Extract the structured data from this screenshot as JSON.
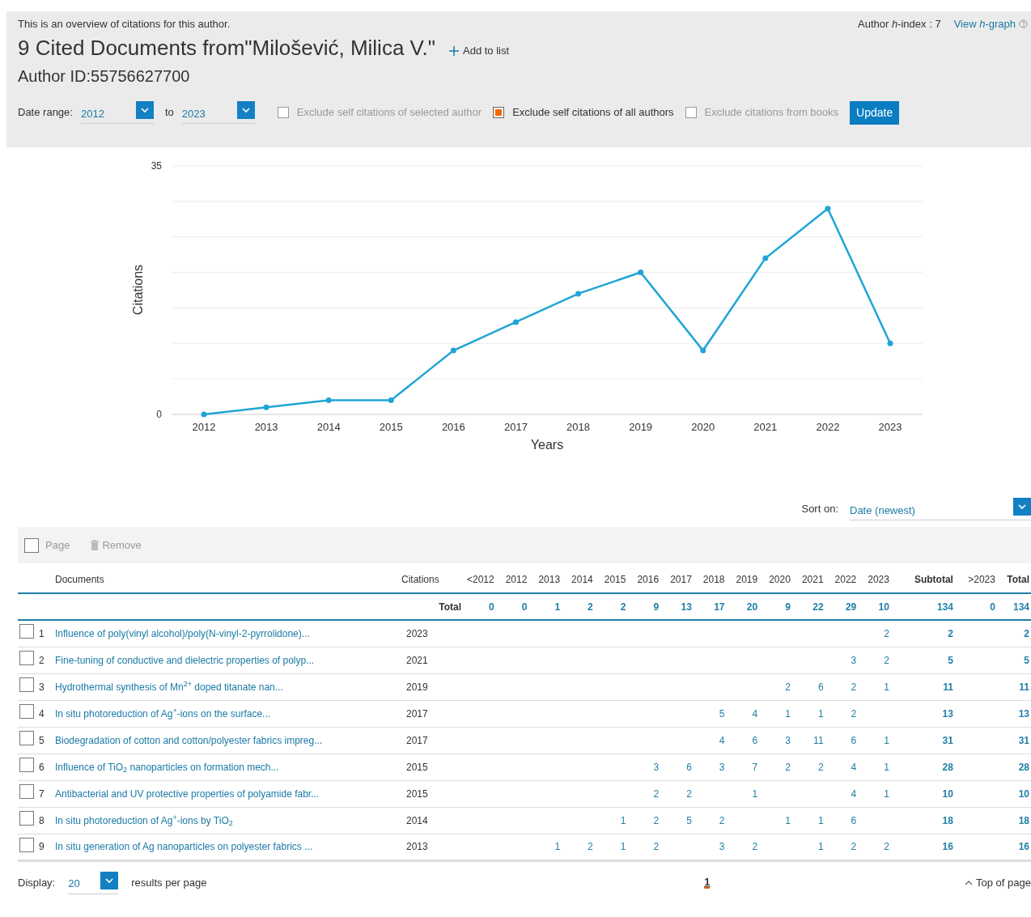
{
  "header": {
    "intro": "This is an overview of citations for this author.",
    "h_index": "Author *h*-index : 7",
    "h_graph_link": "View *h*-graph",
    "title": "9 Cited Documents from\"Milošević, Milica V.\"",
    "add_to_list": "Add to list",
    "author_id": "Author ID:55756627700"
  },
  "date_range": {
    "label": "Date range:",
    "from": "2012",
    "to_label": "to",
    "to": "2023"
  },
  "filters": [
    {
      "label": "Exclude self citations of selected author",
      "checked": false
    },
    {
      "label": "Exclude self citations of all authors",
      "checked": true
    },
    {
      "label": "Exclude citations from books",
      "checked": false
    }
  ],
  "update_button": "Update",
  "chart": {
    "chart_data": {
      "type": "line",
      "xlabel": "Years",
      "ylabel": "Citations",
      "categories": [
        "2012",
        "2013",
        "2014",
        "2015",
        "2016",
        "2017",
        "2018",
        "2019",
        "2020",
        "2021",
        "2022",
        "2023"
      ],
      "series": [
        {
          "color": "#1fa5d6",
          "marker": "circle",
          "values": [
            0,
            1,
            2,
            2,
            9,
            13,
            17,
            20,
            9,
            22,
            29,
            10
          ]
        }
      ],
      "ylim": [
        0,
        35
      ],
      "yticks": [
        0,
        35
      ]
    }
  },
  "sort": {
    "label": "Sort on:",
    "value": "Date (newest)"
  },
  "toolbar": {
    "page_label": "Page",
    "page_checked": false,
    "remove": "Remove"
  },
  "table": {
    "columns": [
      "Documents",
      "Citations",
      "<2012",
      "2012",
      "2013",
      "2014",
      "2015",
      "2016",
      "2017",
      "2018",
      "2019",
      "2020",
      "2021",
      "2022",
      "2023",
      "Subtotal",
      ">2023",
      "Total"
    ],
    "total_row": {
      "label": "Total",
      "values": [
        "0",
        "0",
        "1",
        "2",
        "2",
        "9",
        "13",
        "17",
        "20",
        "9",
        "22",
        "29",
        "10",
        "134",
        "0",
        "134"
      ]
    },
    "rows": [
      {
        "number": "1",
        "title": "Influence of poly(vinyl alcohol)/poly(N-vinyl-2-pyrrolidone)...",
        "year": "2023",
        "checked": false,
        "cells": {
          "col_13": "2",
          "col_14": "2",
          "col_16": "2"
        }
      },
      {
        "number": "2",
        "title": "Fine-tuning of conductive and dielectric properties of polyp...",
        "year": "2021",
        "checked": false,
        "cells": {
          "col_12": "3",
          "col_13": "2",
          "col_14": "5",
          "col_16": "5"
        }
      },
      {
        "number": "3",
        "title": "Hydrothermal synthesis of Mn$^{2+}$ doped titanate nan...",
        "year": "2019",
        "checked": false,
        "cells": {
          "col_10": "2",
          "col_11": "6",
          "col_12": "2",
          "col_13": "1",
          "col_14": "11",
          "col_16": "11"
        }
      },
      {
        "number": "4",
        "title": "In situ photoreduction of Ag$^{+}$-ions on the surface...",
        "year": "2017",
        "checked": false,
        "cells": {
          "col_08": "5",
          "col_09": "4",
          "col_10": "1",
          "col_11": "1",
          "col_12": "2",
          "col_14": "13",
          "col_16": "13"
        }
      },
      {
        "number": "5",
        "title": "Biodegradation of cotton and cotton/polyester fabrics impreg...",
        "year": "2017",
        "checked": false,
        "cells": {
          "col_08": "4",
          "col_09": "6",
          "col_10": "3",
          "col_11": "11",
          "col_12": "6",
          "col_13": "1",
          "col_14": "31",
          "col_16": "31"
        }
      },
      {
        "number": "6",
        "title": "Influence of TiO$_{2}$ nanoparticles on formation mech...",
        "year": "2015",
        "checked": false,
        "cells": {
          "col_06": "3",
          "col_07": "6",
          "col_08": "3",
          "col_09": "7",
          "col_10": "2",
          "col_11": "2",
          "col_12": "4",
          "col_13": "1",
          "col_14": "28",
          "col_16": "28"
        }
      },
      {
        "number": "7",
        "title": "Antibacterial and UV protective properties of polyamide fabr...",
        "year": "2015",
        "checked": false,
        "cells": {
          "col_06": "2",
          "col_07": "2",
          "col_09": "1",
          "col_12": "4",
          "col_13": "1",
          "col_14": "10",
          "col_16": "10"
        }
      },
      {
        "number": "8",
        "title": "In situ photoreduction of Ag$^{+}$-ions by TiO$_{2}$",
        "year": "2014",
        "checked": false,
        "cells": {
          "col_05": "1",
          "col_06": "2",
          "col_07": "5",
          "col_08": "2",
          "col_10": "1",
          "col_11": "1",
          "col_12": "6",
          "col_14": "18",
          "col_16": "18"
        }
      },
      {
        "number": "9",
        "title": "In situ generation of Ag nanoparticles on polyester fabrics ...",
        "year": "2013",
        "checked": false,
        "cells": {
          "col_03": "1",
          "col_04": "2",
          "col_05": "1",
          "col_06": "2",
          "col_08": "3",
          "col_09": "2",
          "col_11": "1",
          "col_12": "2",
          "col_13": "2",
          "col_14": "16",
          "col_16": "16"
        }
      }
    ]
  },
  "footer": {
    "display_label": "Display:",
    "per_page": "20",
    "per_page_suffix": "results per page",
    "pages": [
      {
        "label": "1",
        "selected": true
      }
    ],
    "top_link": "Top of page"
  }
}
